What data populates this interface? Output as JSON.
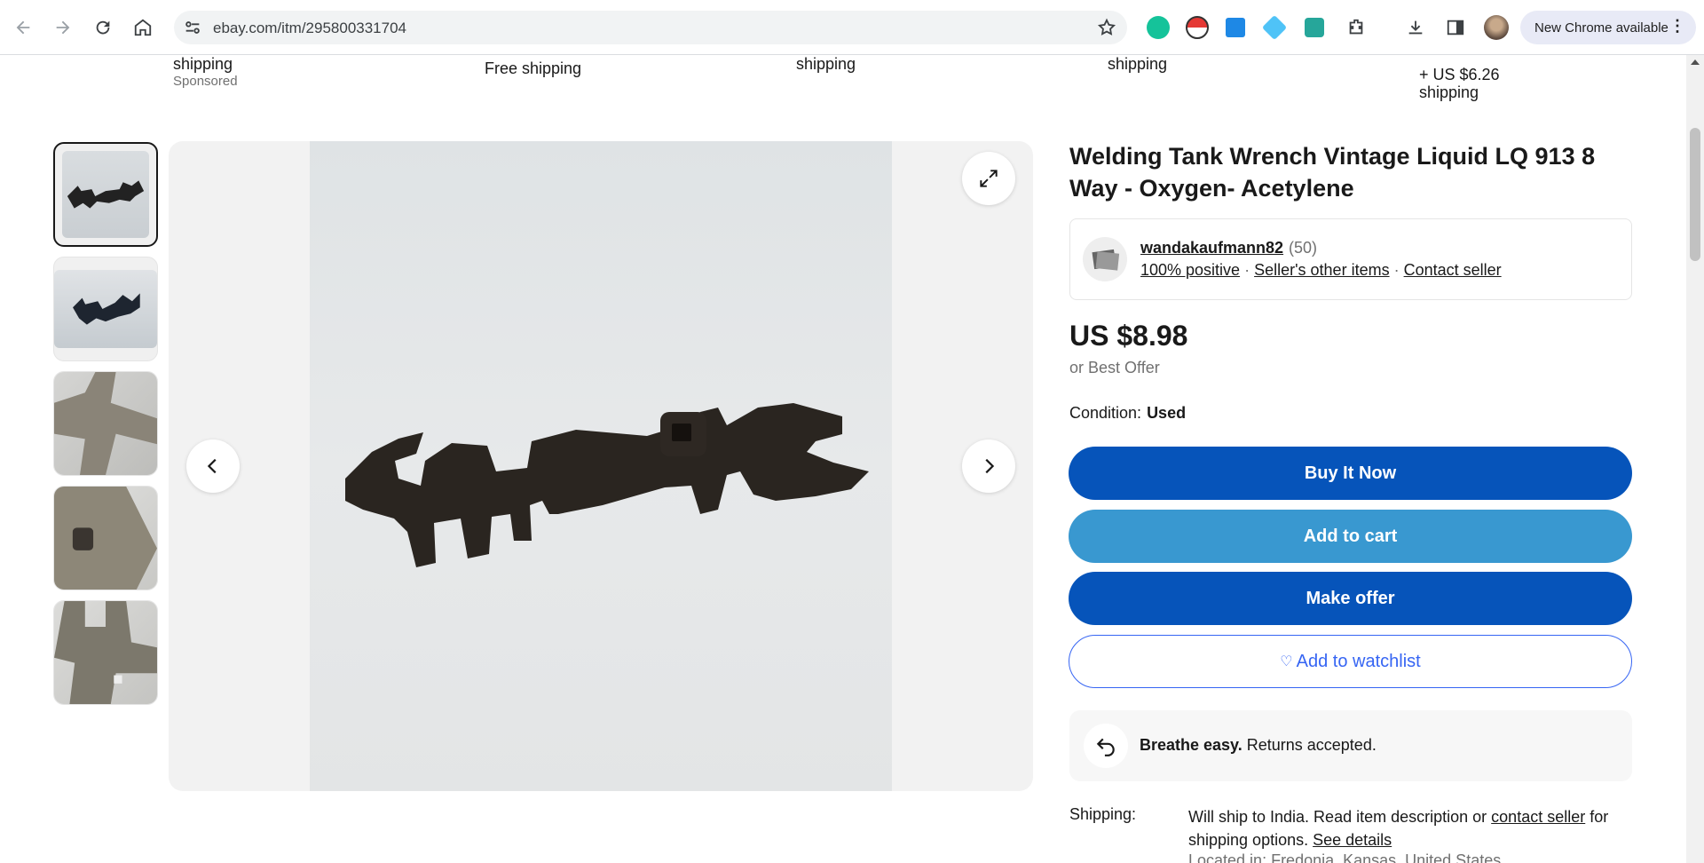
{
  "browser": {
    "url": "ebay.com/itm/295800331704",
    "update_label": "New Chrome available",
    "menu_glyph": "⋮"
  },
  "listing_strip": [
    {
      "line1": "shipping",
      "line2": "Sponsored"
    },
    {
      "line1": "Free shipping",
      "line2": ""
    },
    {
      "line1": "shipping",
      "line2": ""
    },
    {
      "line1": "shipping",
      "line2": ""
    },
    {
      "line1": "+ US $6.26",
      "line2": "shipping"
    }
  ],
  "item": {
    "title": "Welding Tank Wrench Vintage Liquid LQ 913 8 Way - Oxygen- Acetylene",
    "price": "US $8.98",
    "best_offer": "or Best Offer",
    "condition_label": "Condition:",
    "condition_value": "Used"
  },
  "seller": {
    "name": "wandakaufmann82",
    "count": "(50)",
    "positive": "100% positive",
    "other_items": "Seller's other items",
    "contact": "Contact seller"
  },
  "actions": {
    "buy": "Buy It Now",
    "cart": "Add to cart",
    "offer": "Make offer",
    "watch": "Add to watchlist"
  },
  "returns": {
    "bold": "Breathe easy.",
    "rest": "Returns accepted."
  },
  "shipping": {
    "label": "Shipping:",
    "text": "Will ship to India. Read item description or",
    "contact_link": "contact seller",
    "text2": "for shipping options.",
    "details_link": "See details",
    "location": "Located in: Fredonia, Kansas, United States"
  },
  "colors": {
    "primary_blue": "#0654ba",
    "secondary_blue": "#3998d0",
    "link_blue": "#3665f3"
  }
}
